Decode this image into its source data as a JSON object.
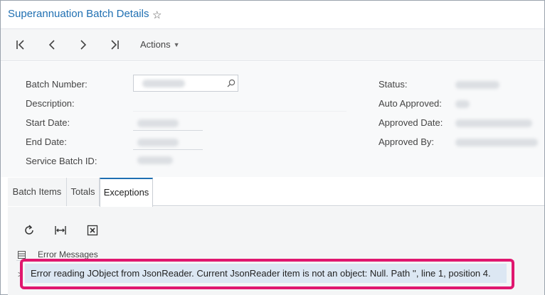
{
  "title": "Superannuation Batch Details",
  "star_icon": "star-outline-icon",
  "toolbar": {
    "first_icon": "first-record-icon",
    "prev_icon": "previous-record-icon",
    "next_icon": "next-record-icon",
    "last_icon": "last-record-icon",
    "actions_label": "Actions"
  },
  "form": {
    "batch_number_label": "Batch Number:",
    "description_label": "Description:",
    "start_date_label": "Start Date:",
    "end_date_label": "End Date:",
    "service_batch_id_label": "Service Batch ID:",
    "status_label": "Status:",
    "auto_approved_label": "Auto Approved:",
    "approved_date_label": "Approved Date:",
    "approved_by_label": "Approved By:"
  },
  "tabs": [
    {
      "label": "Batch Items"
    },
    {
      "label": "Totals"
    },
    {
      "label": "Exceptions"
    }
  ],
  "grid": {
    "refresh_icon": "refresh-icon",
    "fit_columns_icon": "fit-to-width-icon",
    "export_excel_icon": "excel-export-icon",
    "column_header": "Error Messages",
    "rows": [
      {
        "message": "Error reading JObject from JsonReader. Current JsonReader item is not an object: Null. Path '', line 1, position 4."
      }
    ]
  },
  "colors": {
    "title": "#1f6fb2",
    "highlight_border": "#e0176f",
    "selected_row": "#dce7f3"
  }
}
